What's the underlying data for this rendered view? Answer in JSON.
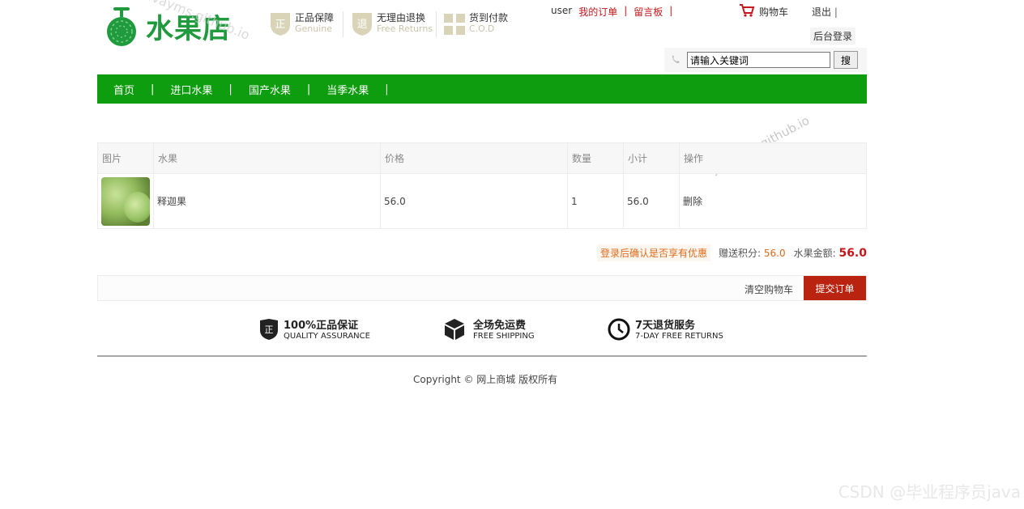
{
  "header": {
    "logo_text": "水果店",
    "watermark": "javayms.github.io",
    "promises": [
      {
        "title": "正品保障",
        "sub": "Genuine",
        "icon": "genuine-badge-icon"
      },
      {
        "title": "无理由退换",
        "sub": "Free Returns",
        "icon": "returns-badge-icon"
      },
      {
        "title": "货到付款",
        "sub": "C.O.D",
        "icon": "cod-badge-icon"
      }
    ],
    "user": "user",
    "my_orders": "我的订单",
    "message_board": "留言板",
    "cart": "购物车",
    "logout": "退出",
    "admin": "后台登录",
    "search_placeholder": "请输入关键词",
    "search_button": "搜"
  },
  "nav": {
    "items": [
      "首页",
      "进口水果",
      "国产水果",
      "当季水果"
    ]
  },
  "cart_table": {
    "headers": [
      "图片",
      "水果",
      "价格",
      "数量",
      "小计",
      "操作"
    ],
    "rows": [
      {
        "name": "释迦果",
        "price": "56.0",
        "qty": "1",
        "subtotal": "56.0",
        "action": "删除"
      }
    ]
  },
  "summary": {
    "login_hint": "登录后确认是否享有优惠",
    "points_label": "赠送积分:",
    "points": "56.0",
    "amount_label": "水果金额:",
    "amount": "56.0"
  },
  "actions": {
    "clear": "清空购物车",
    "submit": "提交订单"
  },
  "guarantees": [
    {
      "title": "100%正品保证",
      "sub": "QUALITY ASSURANCE",
      "icon": "quality-shield-icon"
    },
    {
      "title": "全场免运费",
      "sub": "FREE SHIPPING",
      "icon": "box-icon"
    },
    {
      "title": "7天退货服务",
      "sub": "7-DAY FREE RETURNS",
      "icon": "clock-icon"
    }
  ],
  "footer": {
    "copyright": "Copyright © 网上商城 版权所有"
  },
  "corner_watermark": "CSDN @毕业程序员java",
  "colors": {
    "nav_green": "#0e9d0e",
    "logo_green": "#1f9a3c",
    "accent_red": "#c7161b",
    "submit_red": "#b9230f"
  }
}
